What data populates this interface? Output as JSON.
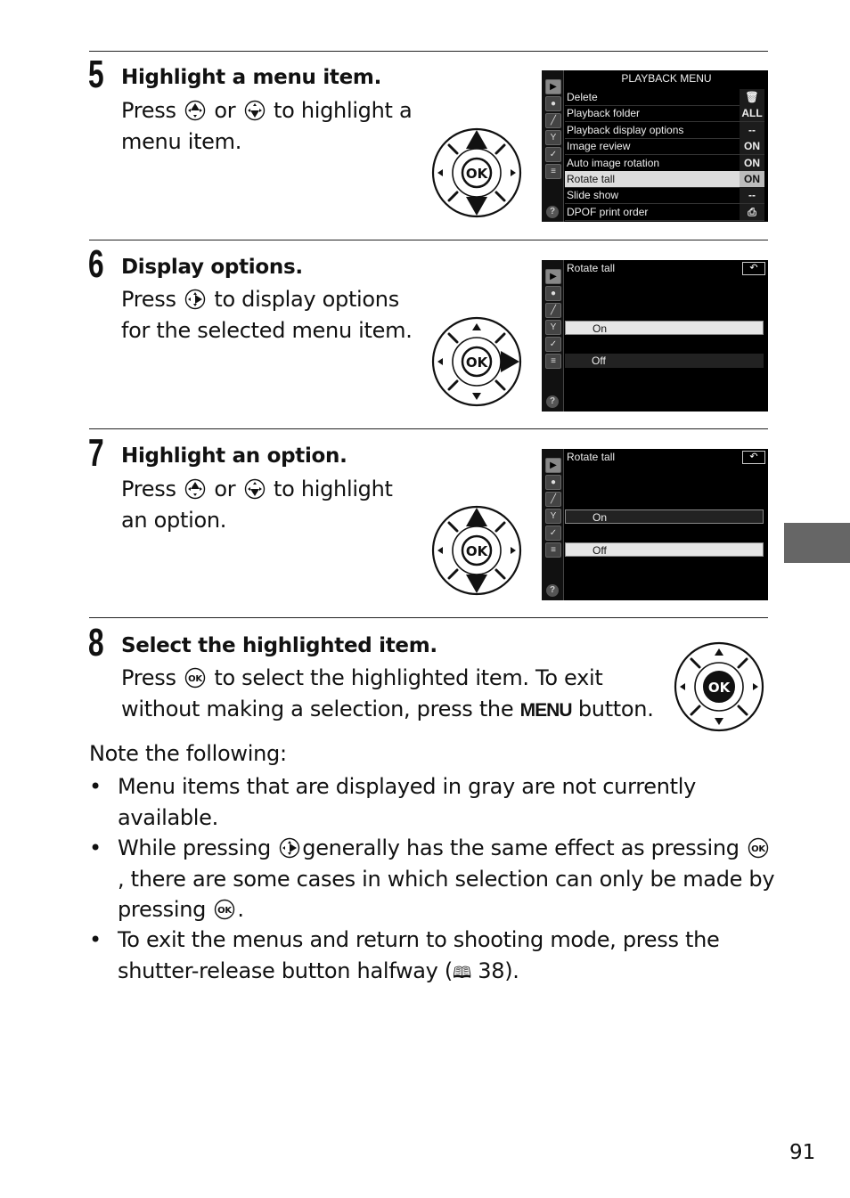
{
  "steps": [
    {
      "number": "5",
      "title": "Highlight a menu item.",
      "body_parts": [
        "Press",
        "or",
        "to highlight a",
        "menu item."
      ],
      "inline_icons": [
        "multi-selector-up-icon",
        "multi-selector-down-icon"
      ],
      "dial_pressed": "up-down"
    },
    {
      "number": "6",
      "title": "Display options.",
      "body_parts": [
        "Press",
        "to display options",
        "for the selected menu item."
      ],
      "inline_icons": [
        "multi-selector-right-icon"
      ],
      "dial_pressed": "right"
    },
    {
      "number": "7",
      "title": "Highlight an option.",
      "body_parts": [
        "Press",
        "or",
        "to highlight",
        "an option."
      ],
      "inline_icons": [
        "multi-selector-up-icon",
        "multi-selector-down-icon"
      ],
      "dial_pressed": "up-down"
    },
    {
      "number": "8",
      "title": "Select the highlighted item.",
      "body_parts": [
        "Press",
        "to select the highlighted item.  To exit",
        "without making a selection, press the",
        "MENU",
        "button."
      ],
      "inline_icons": [
        "ok-button-icon"
      ],
      "dial_pressed": "ok"
    }
  ],
  "screens": {
    "playback_menu": {
      "title": "PLAYBACK MENU",
      "items": [
        {
          "label": "Delete",
          "value": "🗑"
        },
        {
          "label": "Playback folder",
          "value": "ALL"
        },
        {
          "label": "Playback display options",
          "value": "--"
        },
        {
          "label": "Image review",
          "value": "ON"
        },
        {
          "label": "Auto image rotation",
          "value": "ON"
        },
        {
          "label": "Rotate tall",
          "value": "ON",
          "selected": true
        },
        {
          "label": "Slide show",
          "value": "--"
        },
        {
          "label": "DPOF print order",
          "value": "⎙"
        }
      ]
    },
    "rotate_tall_1": {
      "title": "Rotate tall",
      "back_label": "↶",
      "options": [
        {
          "label": "On",
          "highlighted": true
        },
        {
          "label": "Off",
          "highlighted": false
        }
      ]
    },
    "rotate_tall_2": {
      "title": "Rotate tall",
      "back_label": "↶",
      "options": [
        {
          "label": "On",
          "highlighted": false
        },
        {
          "label": "Off",
          "highlighted": true
        }
      ]
    },
    "sidebar_icons": [
      "playback-icon",
      "camera-icon",
      "pencil-icon",
      "wrench-icon",
      "retouch-icon",
      "recent-settings-icon"
    ],
    "help_label": "?"
  },
  "dial": {
    "ok_label": "OK"
  },
  "notes": {
    "intro": "Note the following:",
    "bullets": [
      "Menu items that are displayed in gray are not currently available.",
      [
        "While pressing",
        "generally has the same effect as pressing",
        ", there are some cases in which selection can only be made by pressing",
        "."
      ],
      [
        "To exit the menus and return to shooting mode, press the shutter-release button halfway (",
        "38)."
      ]
    ],
    "bullet_char": "•",
    "book_icon": "🕮"
  },
  "page_number": "91"
}
